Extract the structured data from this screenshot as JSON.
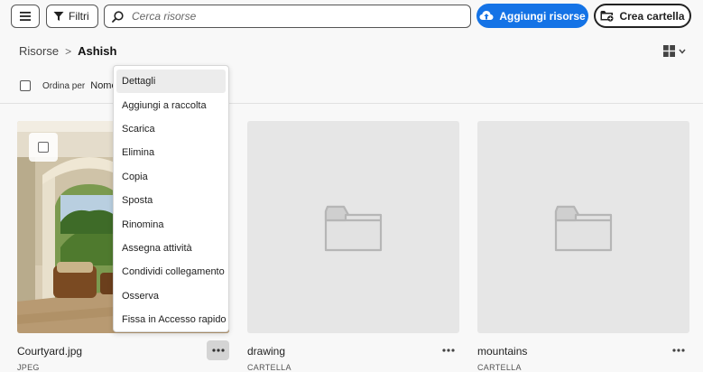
{
  "toolbar": {
    "menu_icon": "hamburger-icon",
    "filters_label": "Filtri",
    "search_placeholder": "Cerca risorse",
    "add_assets_label": "Aggiungi risorse",
    "create_folder_label": "Crea cartella"
  },
  "breadcrumb": {
    "root": "Risorse",
    "separator": ">",
    "current": "Ashish"
  },
  "sort": {
    "label": "Ordina per",
    "value": "Nome"
  },
  "cards": [
    {
      "name": "Courtyard.jpg",
      "type": "JPEG"
    },
    {
      "name": "drawing",
      "type": "CARTELLA"
    },
    {
      "name": "mountains",
      "type": "CARTELLA"
    }
  ],
  "context_menu": {
    "items": [
      "Dettagli",
      "Aggiungi a raccolta",
      "Scarica",
      "Elimina",
      "Copia",
      "Sposta",
      "Rinomina",
      "Assegna attività",
      "Condividi collegamento",
      "Osserva",
      "Fissa in Accesso rapido"
    ]
  },
  "colors": {
    "accent": "#1473e6",
    "background": "#f8f8f8",
    "card_placeholder": "#e6e6e6"
  }
}
